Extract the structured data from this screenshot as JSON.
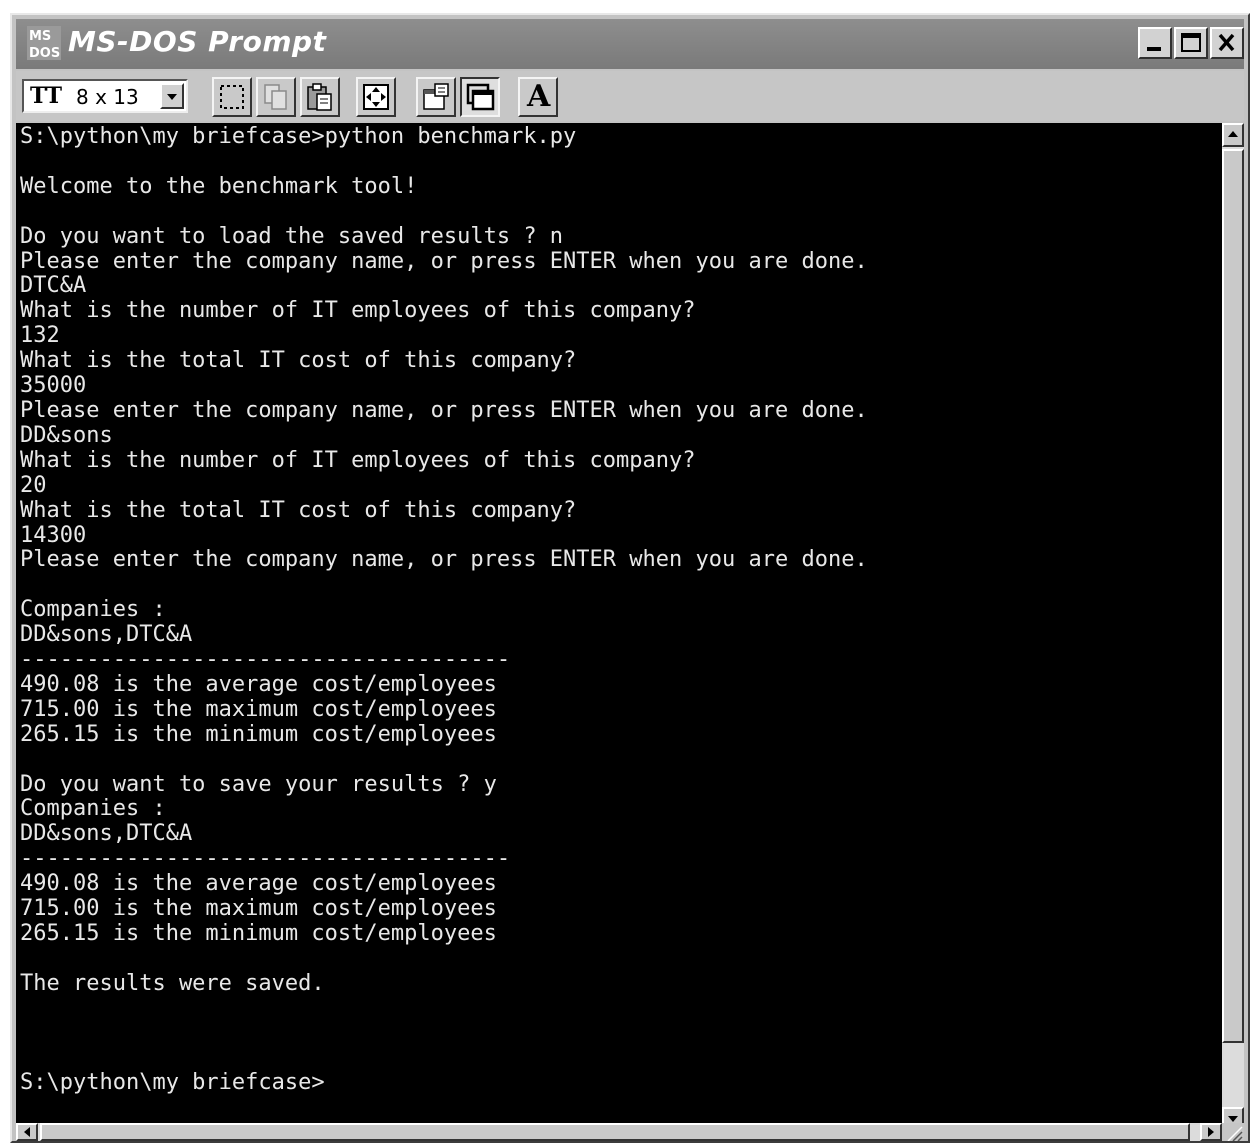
{
  "window": {
    "title": "MS-DOS Prompt",
    "icon": "ms-dos-icon",
    "controls": {
      "minimize": "minimize-icon",
      "maximize": "maximize-icon",
      "close": "close-icon"
    }
  },
  "toolbar": {
    "font_size_value": "8 x 13",
    "font_icon": "TT",
    "buttons": [
      {
        "name": "mark-button",
        "icon": "mark-icon"
      },
      {
        "name": "copy-button",
        "icon": "copy-icon"
      },
      {
        "name": "paste-button",
        "icon": "paste-icon"
      },
      {
        "name": "fullscreen-button",
        "icon": "fullscreen-icon"
      },
      {
        "name": "properties-button",
        "icon": "properties-icon"
      },
      {
        "name": "background-button",
        "icon": "background-icon"
      },
      {
        "name": "font-button",
        "icon": "font-icon",
        "label": "A"
      }
    ]
  },
  "console": {
    "lines": [
      "S:\\python\\my briefcase>python benchmark.py",
      "",
      "Welcome to the benchmark tool!",
      "",
      "Do you want to load the saved results ? n",
      "Please enter the company name, or press ENTER when you are done.",
      "DTC&A",
      "What is the number of IT employees of this company?",
      "132",
      "What is the total IT cost of this company?",
      "35000",
      "Please enter the company name, or press ENTER when you are done.",
      "DD&sons",
      "What is the number of IT employees of this company?",
      "20",
      "What is the total IT cost of this company?",
      "14300",
      "Please enter the company name, or press ENTER when you are done.",
      "",
      "Companies :",
      "DD&sons,DTC&A",
      "-------------------------------------",
      "490.08 is the average cost/employees",
      "715.00 is the maximum cost/employees",
      "265.15 is the minimum cost/employees",
      "",
      "Do you want to save your results ? y",
      "Companies :",
      "DD&sons,DTC&A",
      "-------------------------------------",
      "490.08 is the average cost/employees",
      "715.00 is the maximum cost/employees",
      "265.15 is the minimum cost/employees",
      "",
      "The results were saved.",
      "",
      "",
      "",
      "S:\\python\\my briefcase>"
    ]
  }
}
